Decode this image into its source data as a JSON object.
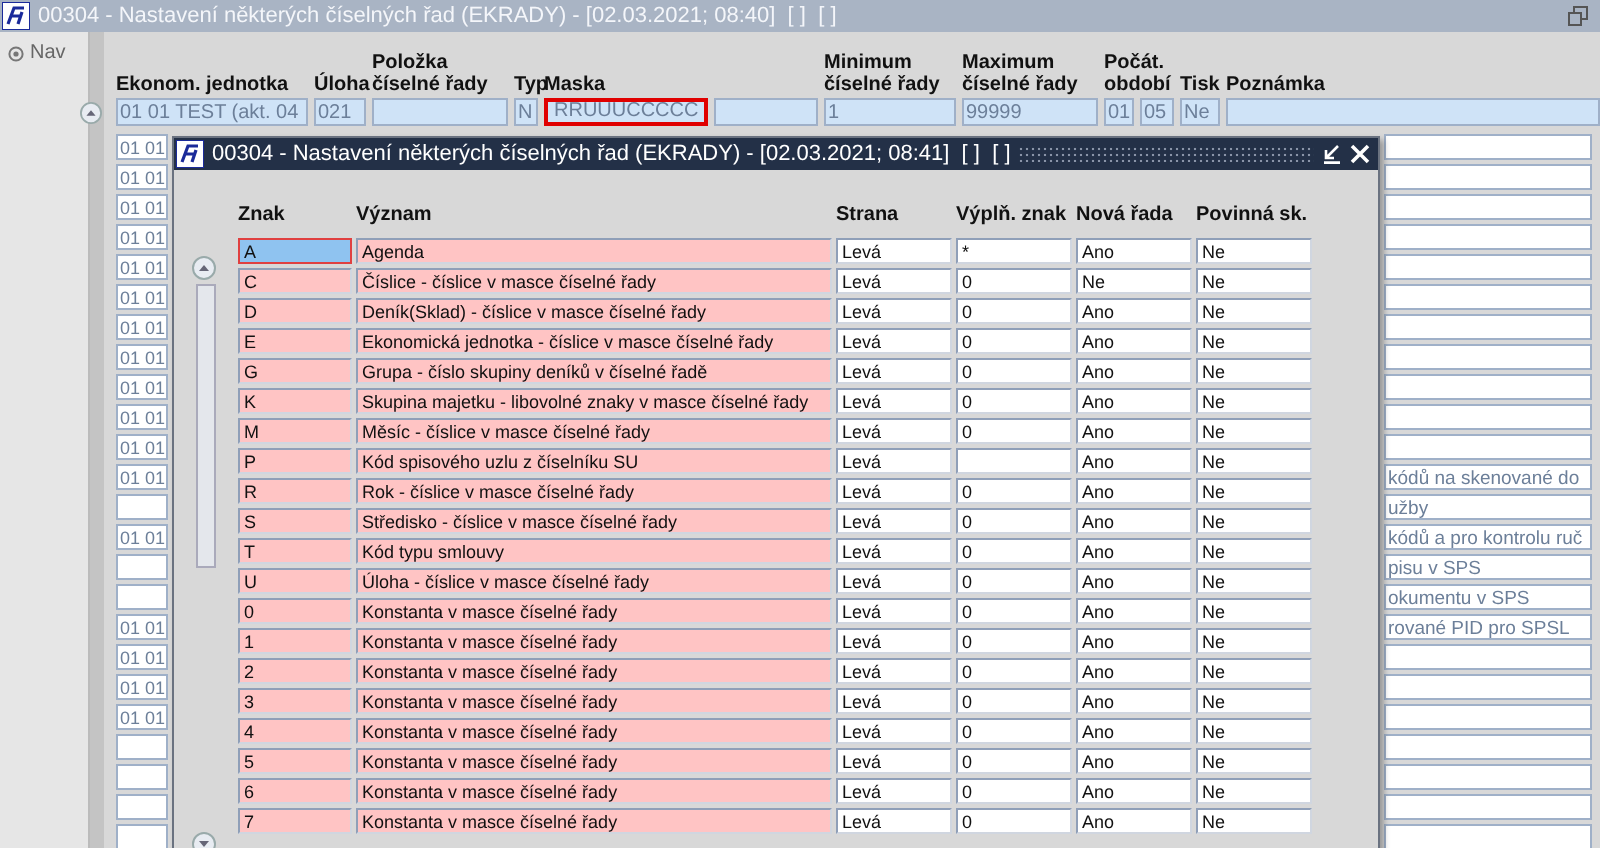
{
  "window": {
    "title": "00304 - Nastavení některých číselných řad (EKRADY) - [02.03.2021; 08:40]  [ ]  [ ]"
  },
  "nav": {
    "label": "Nav"
  },
  "form": {
    "columns": [
      "Ekonom. jednotka",
      "Úloha",
      "Položka číselné řady",
      "Typ",
      "Maska",
      "Minimum číselné řady",
      "Maximum číselné řady",
      "Počát. období",
      "Tisk",
      "Poznámka"
    ],
    "record": {
      "unit": "01 01 TEST (akt. 04",
      "task": "021",
      "type": "N",
      "mask": {
        "value": "RRUUUCCCCC",
        "focused": true
      },
      "minimum": "1",
      "maximum": "99999",
      "period_from": "01",
      "period_to": "05",
      "print": "Ne"
    },
    "rows": [
      {
        "unit": "01 01"
      },
      {
        "unit": "01 01"
      },
      {
        "unit": "01 01"
      },
      {
        "unit": "01 01"
      },
      {
        "unit": "01 01"
      },
      {
        "unit": "01 01"
      },
      {
        "unit": "01 01"
      },
      {
        "unit": "01 01"
      },
      {
        "unit": "01 01"
      },
      {
        "unit": "01 01"
      },
      {
        "unit": "01 01"
      },
      {
        "unit": "01 01",
        "note": "kódů na skenované do"
      },
      {
        "note": "užby"
      },
      {
        "unit": "01 01",
        "note": "kódů a pro kontrolu ruč"
      },
      {
        "note": "pisu v SPS"
      },
      {
        "note": "okumentu v SPS"
      },
      {
        "unit": "01 01",
        "note": "rované PID pro SPSL"
      },
      {
        "unit": "01 01"
      },
      {
        "unit": "01 01"
      },
      {
        "unit": "01 01"
      },
      {},
      {},
      {},
      {}
    ]
  },
  "dialog": {
    "title": "00304 - Nastavení některých číselných řad (EKRADY) - [02.03.2021; 08:41]  [ ]  [ ]",
    "columns": [
      "Znak",
      "Význam",
      "Strana",
      "Výplň. znak",
      "Nová řada",
      "Povinná sk."
    ],
    "rows": [
      {
        "char": "A",
        "meaning": "Agenda",
        "side": "Levá",
        "fill": "*",
        "new_series": "Ano",
        "required": "Ne",
        "selected": true
      },
      {
        "char": "C",
        "meaning": "Číslice - číslice v masce číselné řady",
        "side": "Levá",
        "fill": "0",
        "new_series": "Ne",
        "required": "Ne",
        "selected": false
      },
      {
        "char": "D",
        "meaning": "Deník(Sklad) - číslice v masce číselné řady",
        "side": "Levá",
        "fill": "0",
        "new_series": "Ano",
        "required": "Ne",
        "selected": false
      },
      {
        "char": "E",
        "meaning": "Ekonomická jednotka - číslice v masce číselné řady",
        "side": "Levá",
        "fill": "0",
        "new_series": "Ano",
        "required": "Ne",
        "selected": false
      },
      {
        "char": "G",
        "meaning": "Grupa - číslo skupiny deníků v číselné řadě",
        "side": "Levá",
        "fill": "0",
        "new_series": "Ano",
        "required": "Ne",
        "selected": false
      },
      {
        "char": "K",
        "meaning": "Skupina majetku - libovolné znaky v masce číselné řady",
        "side": "Levá",
        "fill": "0",
        "new_series": "Ano",
        "required": "Ne",
        "selected": false
      },
      {
        "char": "M",
        "meaning": "Měsíc - číslice v masce číselné řady",
        "side": "Levá",
        "fill": "0",
        "new_series": "Ano",
        "required": "Ne",
        "selected": false
      },
      {
        "char": "P",
        "meaning": "Kód spisového uzlu z číselníku SU",
        "side": "Levá",
        "new_series": "Ano",
        "required": "Ne",
        "selected": false
      },
      {
        "char": "R",
        "meaning": "Rok - číslice v masce číselné řady",
        "side": "Levá",
        "fill": "0",
        "new_series": "Ano",
        "required": "Ne",
        "selected": false
      },
      {
        "char": "S",
        "meaning": "Středisko - číslice v masce číselné řady",
        "side": "Levá",
        "fill": "0",
        "new_series": "Ano",
        "required": "Ne",
        "selected": false
      },
      {
        "char": "T",
        "meaning": "Kód typu smlouvy",
        "side": "Levá",
        "fill": "0",
        "new_series": "Ano",
        "required": "Ne",
        "selected": false
      },
      {
        "char": "U",
        "meaning": "Úloha - číslice v masce číselné řady",
        "side": "Levá",
        "fill": "0",
        "new_series": "Ano",
        "required": "Ne",
        "selected": false
      },
      {
        "char": "0",
        "meaning": "Konstanta v masce číselné řady",
        "side": "Levá",
        "fill": "0",
        "new_series": "Ano",
        "required": "Ne",
        "selected": false
      },
      {
        "char": "1",
        "meaning": "Konstanta v masce číselné řady",
        "side": "Levá",
        "fill": "0",
        "new_series": "Ano",
        "required": "Ne",
        "selected": false
      },
      {
        "char": "2",
        "meaning": "Konstanta v masce číselné řady",
        "side": "Levá",
        "fill": "0",
        "new_series": "Ano",
        "required": "Ne",
        "selected": false
      },
      {
        "char": "3",
        "meaning": "Konstanta v masce číselné řady",
        "side": "Levá",
        "fill": "0",
        "new_series": "Ano",
        "required": "Ne",
        "selected": false
      },
      {
        "char": "4",
        "meaning": "Konstanta v masce číselné řady",
        "side": "Levá",
        "fill": "0",
        "new_series": "Ano",
        "required": "Ne",
        "selected": false
      },
      {
        "char": "5",
        "meaning": "Konstanta v masce číselné řady",
        "side": "Levá",
        "fill": "0",
        "new_series": "Ano",
        "required": "Ne",
        "selected": false
      },
      {
        "char": "6",
        "meaning": "Konstanta v masce číselné řady",
        "side": "Levá",
        "fill": "0",
        "new_series": "Ano",
        "required": "Ne",
        "selected": false
      },
      {
        "char": "7",
        "meaning": "Konstanta v masce číselné řady",
        "side": "Levá",
        "fill": "0",
        "new_series": "Ano",
        "required": "Ne",
        "selected": false
      }
    ]
  }
}
